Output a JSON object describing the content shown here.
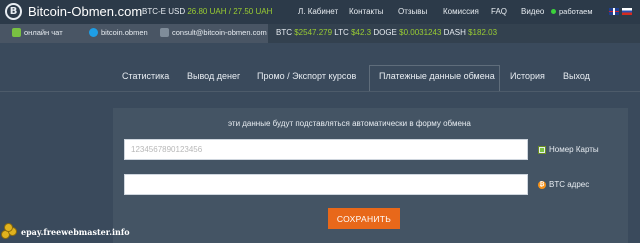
{
  "header": {
    "site_name": "Bitcoin-Obmen.com",
    "logo_letter": "B",
    "rate_pair": "BTC-E",
    "rate_currency": "USD",
    "rate_buy": "26.80",
    "rate_buy_unit": "UAH",
    "rate_sep": "/",
    "rate_sell": "27.50",
    "rate_sell_unit": "UAH",
    "nav": [
      "Л. Кабинет",
      "Контакты",
      "Отзывы",
      "Комиссия",
      "FAQ",
      "Видео"
    ],
    "status": "работаем"
  },
  "contacts": {
    "chat": "онлайн чат",
    "skype": "bitcoin.obmen",
    "email": "consult@bitcoin-obmen.com"
  },
  "ticker": [
    {
      "coin": "BTC",
      "price": "$2547.279"
    },
    {
      "coin": "LTC",
      "price": "$42.3"
    },
    {
      "coin": "DOGE",
      "price": "$0.0031243"
    },
    {
      "coin": "DASH",
      "price": "$182.03"
    }
  ],
  "tabs": [
    "Статистика",
    "Вывод денег",
    "Промо / Экспорт курсов",
    "Платежные данные обмена",
    "История",
    "Выход"
  ],
  "form": {
    "hint": "эти данные будут подставляться автоматически в форму обмена",
    "card_placeholder": "1234567890123456",
    "card_label": "Номер Карты",
    "btc_value": "",
    "btc_label": "BTC адрес",
    "save_label": "СОХРАНИТЬ"
  },
  "watermark": "epay.freewebmaster.info",
  "colors": {
    "background": "#3a4a5c",
    "topbar": "#2c3a49",
    "panel": "#445464",
    "accent_orange": "#e8681a",
    "price_green": "#9acd32",
    "online_green": "#3bd23b"
  }
}
